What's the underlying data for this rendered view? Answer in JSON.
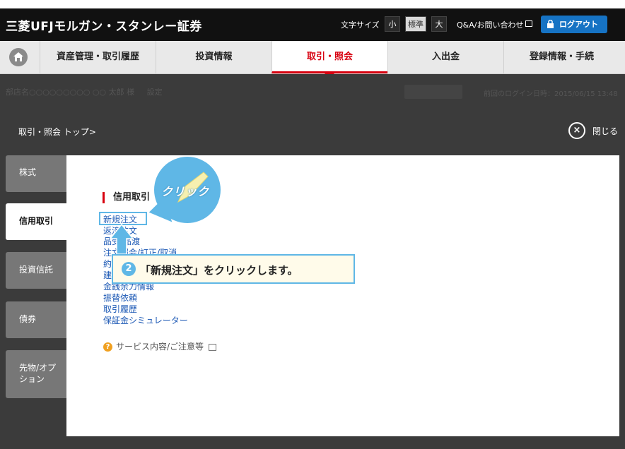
{
  "header": {
    "brand": "三菱UFJモルガン・スタンレー証券",
    "font_size_label": "文字サイズ",
    "font_sizes": [
      "小",
      "標準",
      "大"
    ],
    "qa_label": "Q&A/お問い合わせ",
    "logout_label": "ログアウト"
  },
  "nav": {
    "items": [
      "資産管理・取引履歴",
      "投資情報",
      "取引・照会",
      "入出金",
      "登録情報・手続"
    ],
    "active": "取引・照会"
  },
  "dimmed_account": {
    "account_line": "部店名○○○○○○○○○ ○○ 太郎 様",
    "settings_label": "設定",
    "last_login": "前回のログイン日時：2015/06/15 13:48"
  },
  "breadcrumb": "取引・照会 トップ>",
  "close_label": "閉じる",
  "sidebar": {
    "items": [
      "株式",
      "信用取引",
      "投資信託",
      "債券",
      "先物/オプション"
    ],
    "active": "信用取引"
  },
  "section": {
    "title": "信用取引",
    "links": [
      "新規注文",
      "返済注文",
      "品受/品渡",
      "注文照会/訂正/取消",
      "約定照会",
      "建玉照会",
      "金銭余力情報",
      "振替依頼",
      "取引履歴",
      "保証金シミュレーター"
    ],
    "service_link": "サービス内容/ご注意等"
  },
  "annotation": {
    "bubble_text": "クリック",
    "step_number": "2",
    "instruction": "「新規注文」をクリックします。"
  },
  "colors": {
    "accent_red": "#d7000f",
    "button_blue": "#1673c4",
    "annotation_blue": "#5fb7e6",
    "link_blue": "#1a57b4"
  }
}
